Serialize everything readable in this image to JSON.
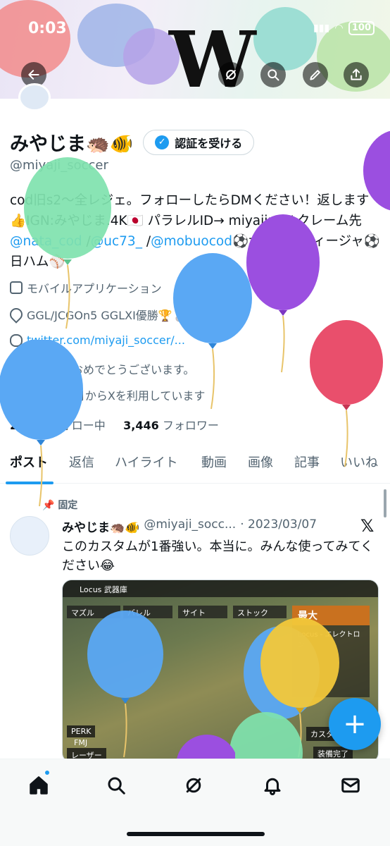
{
  "status_bar": {
    "time": "0:03",
    "battery": "100"
  },
  "header_actions": [
    "back",
    "grok",
    "search",
    "edit",
    "share"
  ],
  "banner": {
    "big_text": "W"
  },
  "profile": {
    "display_name": "みやじま🦔🐠",
    "verify_button": "認証を受ける",
    "handle": "@miyaji_soccer",
    "bio_parts": [
      {
        "text": "cod旧s2〜全レジェ。フォローしたらDMください！返します👍IGN:みやじま.4K🇯🇵 パラレルID→ miyajima/ クレーム先",
        "link": false
      },
      {
        "text": "@nata_cod",
        "link": true
      },
      {
        "text": " /",
        "link": false
      },
      {
        "text": "@uc73_",
        "link": true
      },
      {
        "text": " /",
        "link": false
      },
      {
        "text": "@mobuocod",
        "link": true
      },
      {
        "text": "⚽大宮アルディージャ⚽日ハム⚾",
        "link": false
      }
    ],
    "category": "モバイルアプリケーション",
    "location": "GGL/JCGOn5 GGLXI優勝🏆🥈8🥈2🥉1",
    "website": "twitter.com/miyaji_soccer/...",
    "birthday": "お誕生日おめでとうございます。",
    "joined": "2017年4月からXを利用しています",
    "following_count": "2,233",
    "following_label": "フォロー中",
    "followers_count": "3,446",
    "followers_label": "フォロワー"
  },
  "tabs": [
    "ポスト",
    "返信",
    "ハイライト",
    "動画",
    "画像",
    "記事",
    "いいね"
  ],
  "active_tab": 0,
  "post": {
    "pinned_label": "固定",
    "author_name": "みやじま🦔🐠",
    "author_handle": "@miyaji_socc...",
    "date": "· 2023/03/07",
    "text": "このカスタムが1番強い。本当に。みんな使ってみてください😂",
    "media": {
      "title": "Locus 武器庫",
      "slots": [
        "マズル",
        "バレル",
        "サイト",
        "ストック"
      ],
      "side_title": "最大",
      "side_sub": "Locus - エレクトロン",
      "perk": "PERK",
      "perk_value": "FMJ",
      "laser": "レーザー",
      "custom": "カスタ",
      "done": "装備完了"
    }
  },
  "fab_label": "+",
  "bottom_nav": [
    "home",
    "search",
    "grok",
    "notifications",
    "messages"
  ],
  "colors": {
    "accent": "#1d9bf0",
    "text": "#0f1419",
    "secondary": "#536471"
  },
  "balloons": [
    "green",
    "purple",
    "blue",
    "purple",
    "red",
    "blue",
    "blue",
    "blue",
    "yellow",
    "green",
    "purple"
  ]
}
